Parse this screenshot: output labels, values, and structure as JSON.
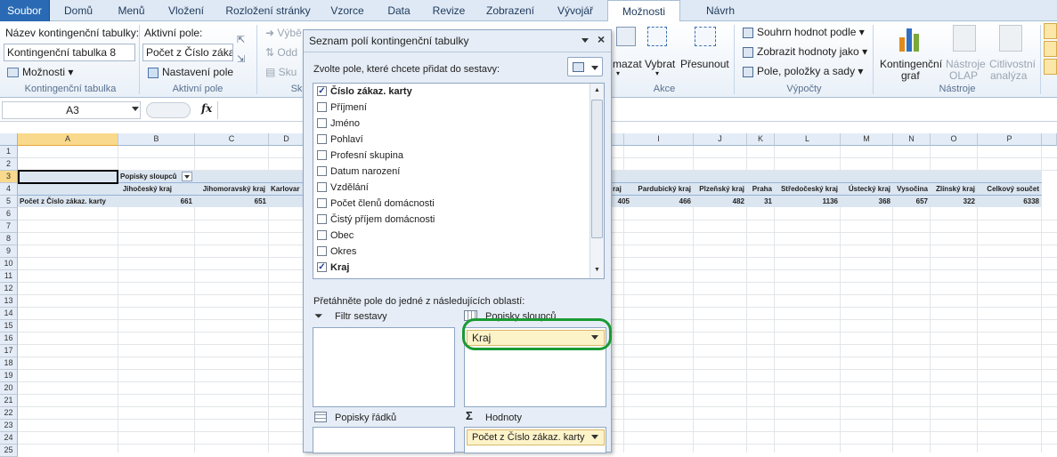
{
  "tabs": [
    "Soubor",
    "Domů",
    "Menů",
    "Vložení",
    "Rozložení stránky",
    "Vzorce",
    "Data",
    "Revize",
    "Zobrazení",
    "Vývojář",
    "Možnosti",
    "Návrh"
  ],
  "ribbon": {
    "pivot_name_label": "Název kontingenční tabulky:",
    "pivot_name_value": "Kontingenční tabulka 8",
    "options_label": "Možnosti",
    "group_pivot": "Kontingenční tabulka",
    "active_field_label": "Aktivní pole:",
    "active_field_value": "Počet z Číslo zákaz.",
    "field_settings": "Nastavení pole",
    "group_active": "Aktivní pole",
    "dim_1": "Výbě",
    "dim_2": "Odd",
    "dim_3": "Sku",
    "group_partial": "Sk",
    "clear_partial": "mazat",
    "select": "Vybrat",
    "move": "Přesunout",
    "group_actions": "Akce",
    "summarize": "Souhrn hodnot podle",
    "show_values": "Zobrazit hodnoty jako",
    "fields_items": "Pole, položky a sady",
    "group_calc": "Výpočty",
    "pivot_chart_1": "Kontingenční",
    "pivot_chart_2": "graf",
    "olap_1": "Nástroje",
    "olap_2": "OLAP",
    "whatif_1": "Citlivostní",
    "whatif_2": "analýza",
    "group_tools": "Nástroje"
  },
  "formula_bar": {
    "name_box": "A3",
    "fx": "fx",
    "formula": ""
  },
  "sheet": {
    "columns": [
      "A",
      "B",
      "C",
      "D",
      "I",
      "J",
      "K",
      "L",
      "M",
      "N",
      "O",
      "P"
    ],
    "rows": [
      "1",
      "2",
      "3",
      "4",
      "5",
      "6",
      "7",
      "8",
      "9",
      "10",
      "11",
      "12",
      "13",
      "14",
      "15",
      "16",
      "17",
      "18",
      "19",
      "20",
      "21",
      "22",
      "23",
      "24",
      "25"
    ],
    "col_labels_header": "Popisky sloupců",
    "row_label": "Počet z Číslo zákaz. karty",
    "headers": [
      "Jihočeský kraj",
      "Jihomoravský kraj",
      "Karlovar",
      "raj",
      "Pardubický kraj",
      "Plzeňský kraj",
      "Praha",
      "Středočeský kraj",
      "Ústecký kraj",
      "Vysočina",
      "Zlínský kraj",
      "Celkový součet"
    ],
    "values": [
      "661",
      "651",
      "",
      "405",
      "466",
      "482",
      "31",
      "1136",
      "368",
      "657",
      "322",
      "6338"
    ]
  },
  "panel": {
    "title": "Seznam polí kontingenční tabulky",
    "choose_prompt": "Zvolte pole, které chcete přidat do sestavy:",
    "fields": [
      {
        "label": "Číslo zákaz. karty",
        "checked": true
      },
      {
        "label": "Příjmení",
        "checked": false
      },
      {
        "label": "Jméno",
        "checked": false
      },
      {
        "label": "Pohlaví",
        "checked": false
      },
      {
        "label": "Profesní skupina",
        "checked": false
      },
      {
        "label": "Datum narození",
        "checked": false
      },
      {
        "label": "Vzdělání",
        "checked": false
      },
      {
        "label": "Počet členů domácnosti",
        "checked": false
      },
      {
        "label": "Čistý příjem domácnosti",
        "checked": false
      },
      {
        "label": "Obec",
        "checked": false
      },
      {
        "label": "Okres",
        "checked": false
      },
      {
        "label": "Kraj",
        "checked": true
      }
    ],
    "drag_prompt": "Přetáhněte pole do jedné z následujících oblastí:",
    "zone_filter": "Filtr sestavy",
    "zone_columns": "Popisky sloupců",
    "zone_rows": "Popisky řádků",
    "zone_values": "Hodnoty",
    "column_chip": "Kraj",
    "value_chip": "Počet z Číslo zákaz. karty"
  },
  "colors": {
    "accent": "#2a6ab4",
    "highlight_ring": "#1a9a33",
    "chip": "#fdf3c9"
  }
}
